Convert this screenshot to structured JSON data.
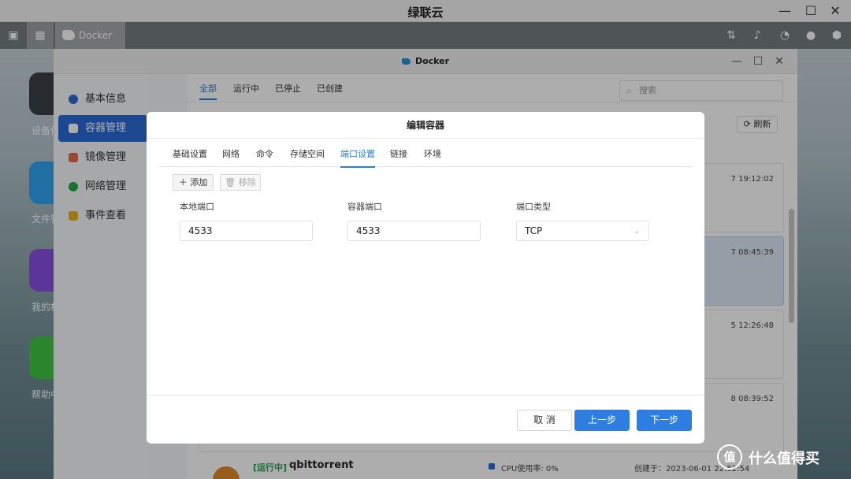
{
  "os": {
    "title": "绿联云",
    "min": "—",
    "max": "☐",
    "close": "✕"
  },
  "taskbar": {
    "app_label": "Docker"
  },
  "desktop": {
    "icons": [
      {
        "label": "设备信"
      },
      {
        "label": "文件管"
      },
      {
        "label": "我的相"
      },
      {
        "label": "帮助中"
      }
    ]
  },
  "window": {
    "title": "Docker",
    "sidebar": [
      {
        "label": "基本信息"
      },
      {
        "label": "容器管理"
      },
      {
        "label": "镜像管理"
      },
      {
        "label": "网络管理"
      },
      {
        "label": "事件查看"
      }
    ],
    "tabs": [
      {
        "label": "全部"
      },
      {
        "label": "运行中"
      },
      {
        "label": "已停止"
      },
      {
        "label": "已创建"
      }
    ],
    "search_placeholder": "搜索",
    "refresh_label": "刷新",
    "card_times": [
      "7 19:12:02",
      "7 08:45:39",
      "5 12:26:48",
      "8 08:39:52"
    ],
    "bottom_container": {
      "status": "[运行中]",
      "name": "qbittorrent",
      "cpu": "CPU使用率: 0%",
      "created": "创建于：2023-06-01 22:52:54"
    }
  },
  "dialog": {
    "title": "编辑容器",
    "tabs": [
      {
        "label": "基础设置"
      },
      {
        "label": "网络"
      },
      {
        "label": "命令"
      },
      {
        "label": "存储空间"
      },
      {
        "label": "端口设置"
      },
      {
        "label": "链接"
      },
      {
        "label": "环境"
      }
    ],
    "add_label": "添加",
    "remove_label": "移除",
    "columns": {
      "local_port": "本地端口",
      "container_port": "容器端口",
      "port_type": "端口类型"
    },
    "row": {
      "local_port": "4533",
      "container_port": "4533",
      "port_type": "TCP"
    },
    "footer": {
      "cancel": "取 消",
      "prev": "上一步",
      "next": "下一步"
    }
  },
  "watermark": {
    "icon": "值",
    "text": "什么值得买"
  }
}
